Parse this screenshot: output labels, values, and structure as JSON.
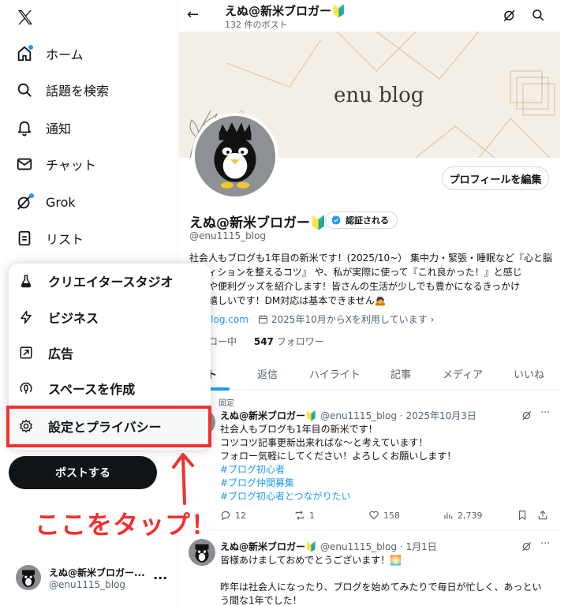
{
  "sidebar": {
    "items": [
      {
        "label": "ホーム",
        "icon": "home-icon"
      },
      {
        "label": "話題を検索",
        "icon": "search-icon"
      },
      {
        "label": "通知",
        "icon": "bell-icon"
      },
      {
        "label": "チャット",
        "icon": "mail-icon"
      },
      {
        "label": "Grok",
        "icon": "grok-icon"
      },
      {
        "label": "リスト",
        "icon": "list-icon"
      }
    ],
    "post_button": "ポストする",
    "account": {
      "name": "えぬ@新米ブロガー...",
      "handle": "@enu1115_blog",
      "more": "···"
    }
  },
  "menu": {
    "items": [
      {
        "label": "クリエイタースタジオ",
        "icon": "flask-icon"
      },
      {
        "label": "ビジネス",
        "icon": "lightning-icon"
      },
      {
        "label": "広告",
        "icon": "arrow-box-icon"
      },
      {
        "label": "スペースを作成",
        "icon": "spaces-icon"
      },
      {
        "label": "設定とプライバシー",
        "icon": "gear-icon"
      }
    ]
  },
  "annotation": {
    "text": "ここをタップ！",
    "color": "#f23030"
  },
  "header": {
    "title": "えぬ@新米ブロガー🔰",
    "subtitle": "132 件のポスト",
    "back": "←"
  },
  "banner": {
    "text": "enu blog"
  },
  "profile": {
    "edit_button": "プロフィールを編集",
    "name": "えぬ@新米ブロガー🔰",
    "verify_label": "認証される",
    "handle": "@enu1115_blog",
    "bio_lines": [
      "社会人もブログも1年目の新米です！(2025/10~）  集中力・緊張・睡眠など『心と脳",
      "ンディションを整えるコツ』 や、私が実際に使って『これ良かった！』と感じ",
      "用品や便利グッズを紹介します！皆さんの生活が少しでも豊かになるきっかけ",
      "れば嬉しいです！DM対応は基本できません🙇"
    ],
    "link": "nu-blog.com",
    "joined": "2025年10月からXを利用しています",
    "following_label": "フォロー中",
    "followers_count": "547",
    "followers_label": "フォロワー"
  },
  "tabs": [
    "スト",
    "返信",
    "ハイライト",
    "記事",
    "メディア",
    "いいね"
  ],
  "posts": [
    {
      "pinned": "固定",
      "name": "えぬ@新米ブロガー🔰",
      "meta": "@enu1115_blog · 2025年10月3日",
      "lines": [
        "社会人もブログも1年目の新米です！",
        "コツコツ記事更新出来ればな〜と考えています！",
        "フォロー気軽にしてください！よろしくお願いします！"
      ],
      "tags": [
        "#ブログ初心者",
        "#ブログ仲間募集",
        "#ブログ初心者とつながりたい"
      ],
      "replies": "12",
      "reposts": "1",
      "likes": "158",
      "views": "2,739"
    },
    {
      "name": "えぬ@新米ブロガー🔰",
      "meta": "@enu1115_blog · 1月1日",
      "lines": [
        "皆様あけましておめでとうございます！🌅",
        "",
        "昨年は社会人になったり、ブログを始めてみたりで毎日が忙しく、あっとい",
        "う間な1年でした！"
      ]
    }
  ]
}
